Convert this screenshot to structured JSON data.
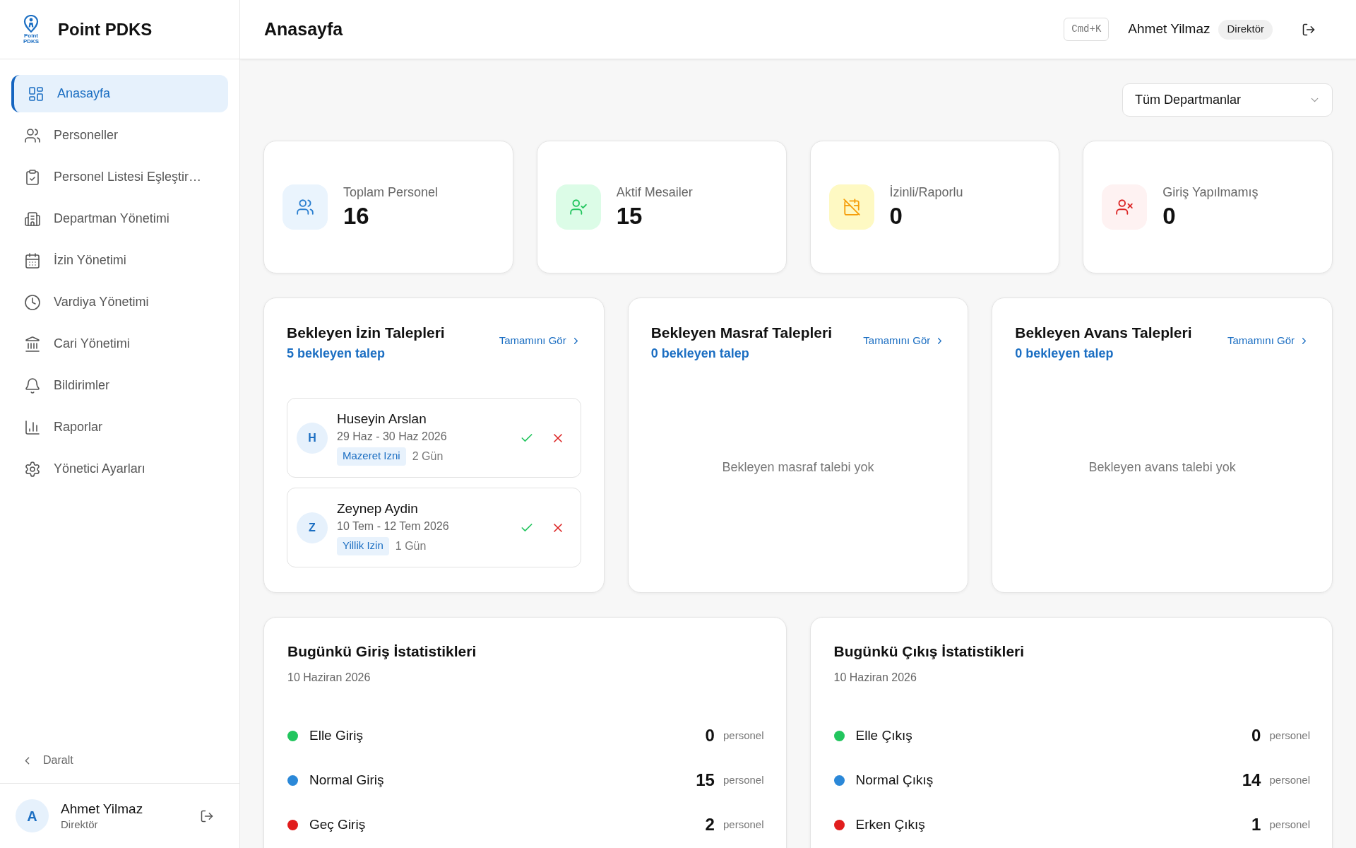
{
  "sidebar": {
    "logo_lines": [
      "Point",
      "PDKS"
    ],
    "brand": "Point PDKS",
    "nav_items": [
      {
        "label": "Anasayfa",
        "selected": true
      },
      {
        "label": "Personeller",
        "selected": false
      },
      {
        "label": "Personel Listesi Eşleştir…",
        "selected": false
      },
      {
        "label": "Departman Yönetimi",
        "selected": false
      },
      {
        "label": "İzin Yönetimi",
        "selected": false
      },
      {
        "label": "Vardiya Yönetimi",
        "selected": false
      },
      {
        "label": "Cari Yönetimi",
        "selected": false
      },
      {
        "label": "Bildirimler",
        "selected": false
      },
      {
        "label": "Raporlar",
        "selected": false
      },
      {
        "label": "Yönetici Ayarları",
        "selected": false
      }
    ],
    "collapse_label": "Daralt",
    "user": {
      "initial": "A",
      "name": "Ahmet Yilmaz",
      "role": "Direktör"
    }
  },
  "header": {
    "title": "Anasayfa",
    "shortcut": "Cmd+K",
    "user_name": "Ahmet Yilmaz",
    "role": "Direktör"
  },
  "department_filter": {
    "value": "Tüm Departmanlar"
  },
  "stat_cards": [
    {
      "kind": "total",
      "label": "Toplam Personel",
      "value": "16"
    },
    {
      "kind": "active",
      "label": "Aktif Mesailer",
      "value": "15"
    },
    {
      "kind": "leave",
      "label": "İzinli/Raporlu",
      "value": "0"
    },
    {
      "kind": "absent",
      "label": "Giriş Yapılmamış",
      "value": "0"
    }
  ],
  "pending_cards": [
    {
      "title": "Bekleyen İzin Talepleri",
      "count_text": "5 bekleyen talep",
      "link": "Tamamını Gör",
      "requests": [
        {
          "initial": "H",
          "name": "Huseyin Arslan",
          "dates": "29 Haz - 30 Haz 2026",
          "type": "Mazeret Izni",
          "duration": "2 Gün"
        },
        {
          "initial": "Z",
          "name": "Zeynep Aydin",
          "dates": "10 Tem - 12 Tem 2026",
          "type": "Yillik Izin",
          "duration": "1 Gün"
        }
      ]
    },
    {
      "title": "Bekleyen Masraf Talepleri",
      "count_text": "0 bekleyen talep",
      "link": "Tamamını Gör",
      "empty_text": "Bekleyen masraf talebi yok"
    },
    {
      "title": "Bekleyen Avans Talepleri",
      "count_text": "0 bekleyen talep",
      "link": "Tamamını Gör",
      "empty_text": "Bekleyen avans talebi yok"
    }
  ],
  "daily_stats": [
    {
      "title": "Bugünkü Giriş İstatistikleri",
      "date": "10 Haziran 2026",
      "rows": [
        {
          "label": "Elle Giriş",
          "count": "0",
          "unit": "personel",
          "color": "#22c55e"
        },
        {
          "label": "Normal Giriş",
          "count": "15",
          "unit": "personel",
          "color": "#2b88d8"
        },
        {
          "label": "Geç Giriş",
          "count": "2",
          "unit": "personel",
          "color": "#e11d1d"
        }
      ]
    },
    {
      "title": "Bugünkü Çıkış İstatistikleri",
      "date": "10 Haziran 2026",
      "rows": [
        {
          "label": "Elle Çıkış",
          "count": "0",
          "unit": "personel",
          "color": "#22c55e"
        },
        {
          "label": "Normal Çıkış",
          "count": "14",
          "unit": "personel",
          "color": "#2b88d8"
        },
        {
          "label": "Erken Çıkış",
          "count": "1",
          "unit": "personel",
          "color": "#e11d1d"
        }
      ]
    }
  ]
}
